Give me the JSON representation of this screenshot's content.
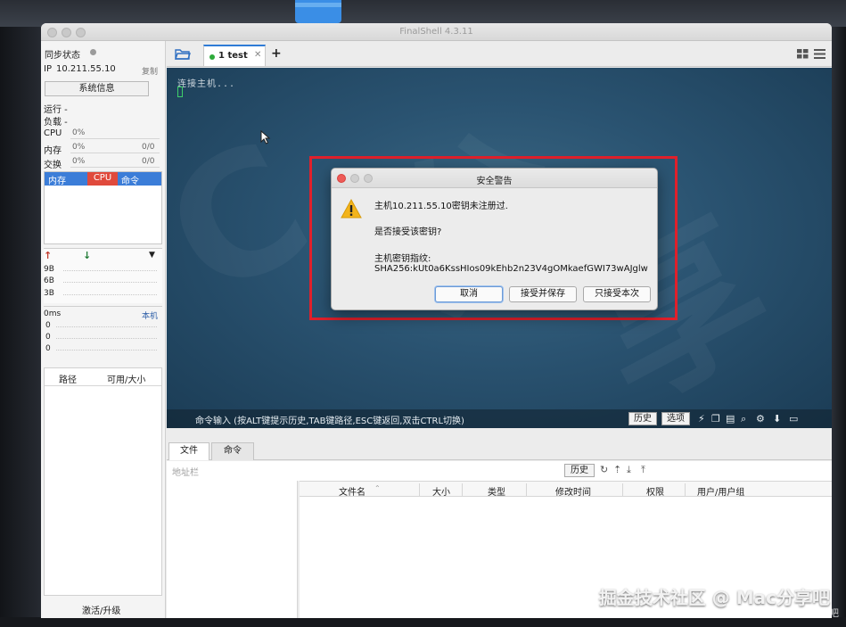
{
  "window": {
    "title": "FinalShell 4.3.11"
  },
  "sidebar": {
    "sync_label": "同步状态",
    "ip_label": "IP",
    "ip_value": "10.211.55.10",
    "copy_label": "复制",
    "sysinfo_button": "系统信息",
    "run_label": "运行 -",
    "load_label": "负载 -",
    "cpu_label": "CPU",
    "cpu_value": "0%",
    "mem_label": "内存",
    "mem_value": "0%",
    "mem_ratio": "0/0",
    "swap_label": "交换",
    "swap_value": "0%",
    "swap_ratio": "0/0",
    "proc_tabs": [
      "内存",
      "CPU",
      "命令"
    ],
    "net_values": [
      "9B",
      "6B",
      "3B"
    ],
    "ping_label": "0ms",
    "ping_host": "本机",
    "ping_values": [
      "0",
      "0",
      "0"
    ],
    "disk_cols": [
      "路径",
      "可用/大小"
    ],
    "activate_label": "激活/升级"
  },
  "tabs": [
    {
      "label": "1 test",
      "status_color": "#2eaa3a"
    }
  ],
  "terminal": {
    "line": "连接主机...",
    "cmd_hint": "命令输入 (按ALT键提示历史,TAB键路径,ESC键返回,双击CTRL切换)",
    "history_button": "历史",
    "options_button": "选项"
  },
  "file_panel": {
    "tabs": [
      "文件",
      "命令"
    ],
    "address_label": "地址栏",
    "history_button": "历史",
    "columns": [
      "文件名",
      "大小",
      "类型",
      "修改时间",
      "权限",
      "用户/用户组"
    ]
  },
  "dialog": {
    "title": "安全警告",
    "line1": "主机10.211.55.10密钥未注册过.",
    "line2": "是否接受该密钥?",
    "line3": "主机密钥指纹:",
    "fingerprint": "SHA256:kUt0a6KssHIos09kEhb2n23V4gOMkaefGWI73wAJglw",
    "buttons": [
      "取消",
      "接受并保存",
      "只接受本次"
    ]
  },
  "watermark": {
    "main": "掘金技术社区 @ Mac分享吧",
    "sub": "CSDN @Mac分享吧"
  },
  "colors": {
    "accent": "#2e7bd6",
    "highlight": "#e0202b",
    "cpu_tab": "#e04a3c",
    "terminal_bg": "#2a5371"
  }
}
